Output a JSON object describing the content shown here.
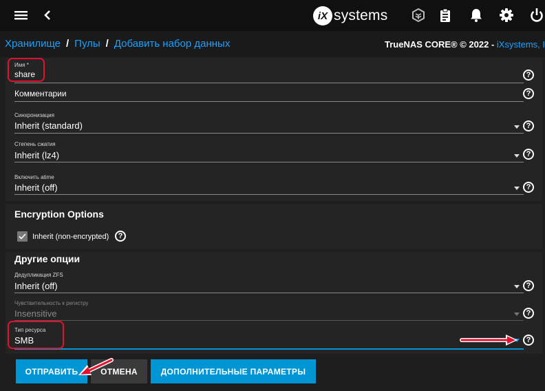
{
  "topbar": {
    "menu_icon": "menu-icon",
    "back_icon": "chevron-left-icon",
    "logo_mark": "iX",
    "logo_text": "systems",
    "icons": [
      "truecommand-icon",
      "clipboard-icon",
      "bell-icon",
      "gear-icon",
      "power-icon"
    ]
  },
  "breadcrumb": {
    "items": [
      "Хранилище",
      "Пулы",
      "Добавить набор данных"
    ],
    "separator": "/"
  },
  "copyright": {
    "text": "TrueNAS CORE® © 2022 - ",
    "vendor": "iXsystems, I"
  },
  "form": {
    "name": {
      "label": "Имя *",
      "value": "share"
    },
    "comments": {
      "placeholder": "Комментарии"
    },
    "sync": {
      "label": "Синхронизация",
      "value": "Inherit (standard)"
    },
    "compression": {
      "label": "Степень сжатия",
      "value": "Inherit (lz4)"
    },
    "atime": {
      "label": "Включить atime",
      "value": "Inherit (off)"
    },
    "encryption": {
      "title": "Encryption Options",
      "checkbox_label": "Inherit (non-encrypted)",
      "checked": true
    },
    "other": {
      "title": "Другие опции"
    },
    "dedup": {
      "label": "Дедупликация ZFS",
      "value": "Inherit (off)"
    },
    "case": {
      "label": "Чувствительность к регистру",
      "value": "Insensitive",
      "disabled": true
    },
    "share_type": {
      "label": "Тип ресурса",
      "value": "SMB"
    },
    "help_glyph": "?"
  },
  "buttons": {
    "submit": "ОТПРАВИТЬ",
    "cancel": "ОТМЕНА",
    "advanced": "ДОПОЛНИТЕЛЬНЫЕ ПАРАМЕТРЫ"
  },
  "colors": {
    "accent": "#0095d5",
    "link": "#1aa1ff",
    "annotation": "#e3102f",
    "background": "#1e1e1e"
  }
}
